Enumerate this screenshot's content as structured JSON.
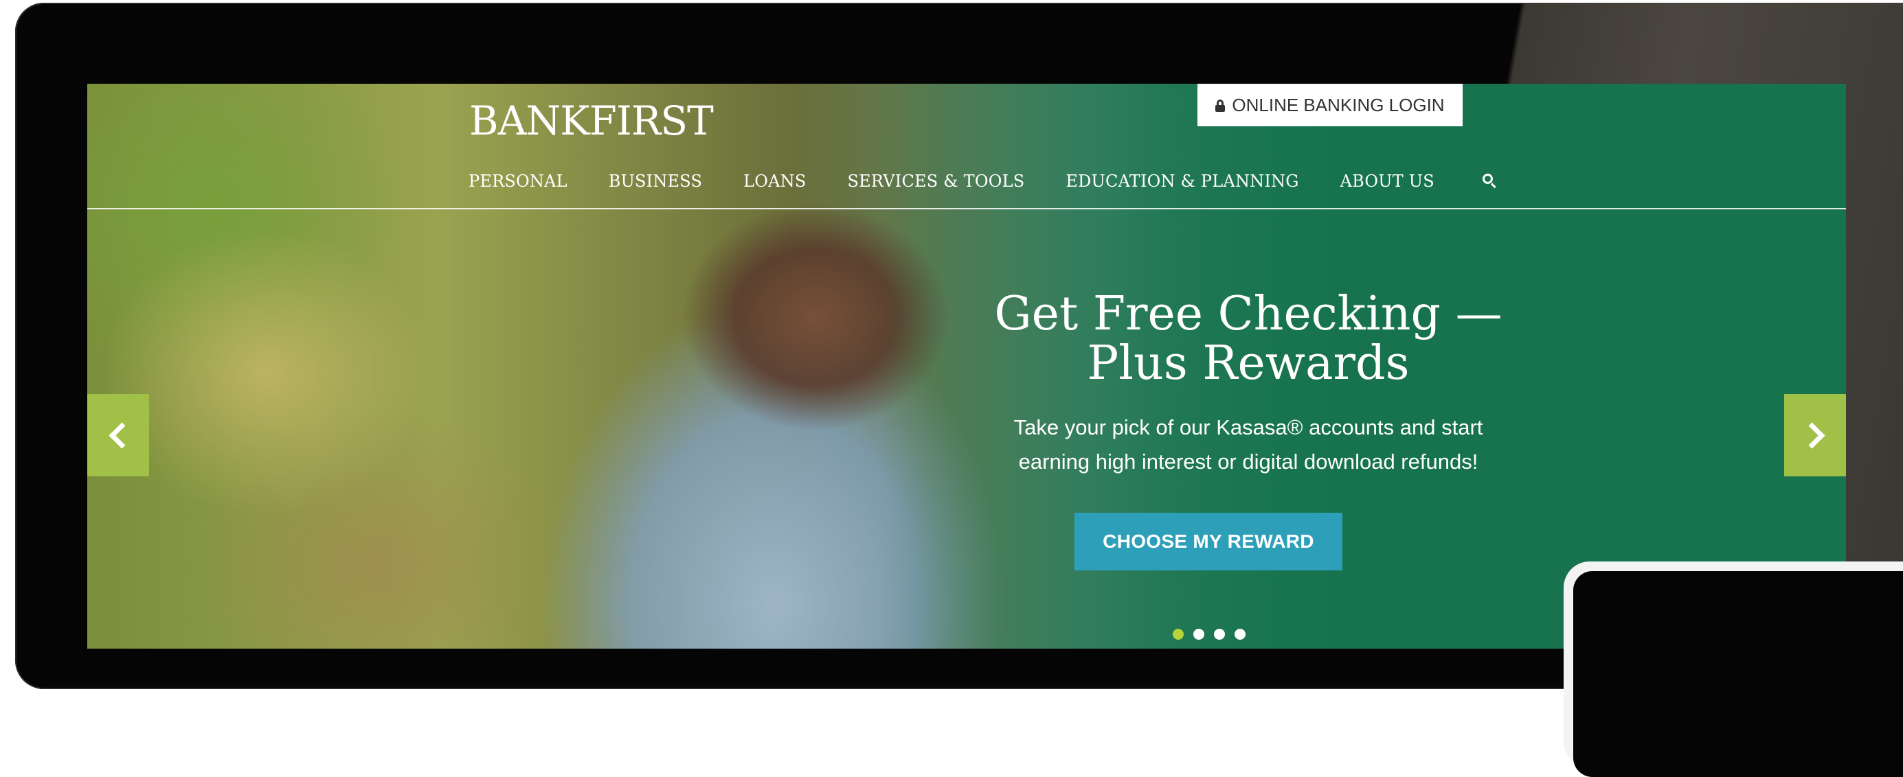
{
  "brand": {
    "logo_text": "BANKFIRST"
  },
  "header": {
    "login_label": "ONLINE BANKING LOGIN",
    "nav": [
      {
        "label": "PERSONAL"
      },
      {
        "label": "BUSINESS"
      },
      {
        "label": "LOANS"
      },
      {
        "label": "SERVICES & TOOLS"
      },
      {
        "label": "EDUCATION & PLANNING"
      },
      {
        "label": "ABOUT US"
      }
    ],
    "search_icon": "search-icon"
  },
  "hero": {
    "title_line1": "Get Free Checking —",
    "title_line2": "Plus Rewards",
    "sub_line1": "Take your pick of our Kasasa® accounts and start",
    "sub_line2": "earning high interest or digital download refunds!",
    "cta_label": "CHOOSE MY REWARD"
  },
  "carousel": {
    "slide_count": 4,
    "active_slide": 1,
    "prev_icon": "chevron-left-icon",
    "next_icon": "chevron-right-icon"
  },
  "colors": {
    "brand_green": "#17734e",
    "accent_lime": "#a0c048",
    "cta_blue": "#2e9fb8",
    "dot_active": "#b5d43a"
  }
}
